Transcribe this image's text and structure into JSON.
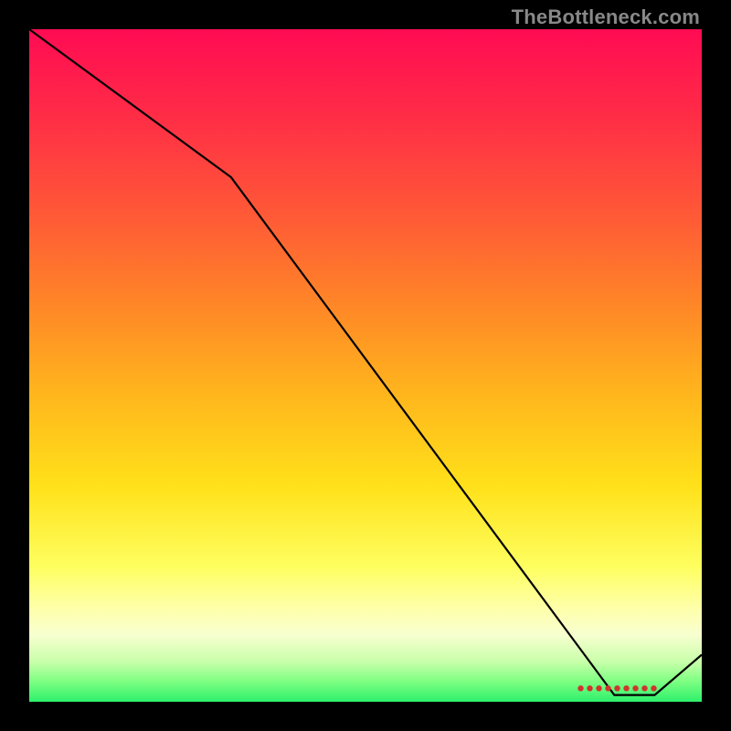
{
  "watermark": "TheBottleneck.com",
  "chart_data": {
    "type": "line",
    "title": "",
    "xlabel": "",
    "ylabel": "",
    "xlim": [
      0,
      100
    ],
    "ylim": [
      0,
      100
    ],
    "x": [
      0,
      30,
      87,
      93,
      100
    ],
    "values": [
      100,
      78,
      1,
      1,
      7
    ],
    "marker_band": {
      "x_start": 82,
      "x_end": 93,
      "y": 2
    },
    "gradient_stops": [
      {
        "pos": 0.0,
        "color": "#ff0b53"
      },
      {
        "pos": 0.12,
        "color": "#ff2a47"
      },
      {
        "pos": 0.28,
        "color": "#ff5a36"
      },
      {
        "pos": 0.42,
        "color": "#ff8a26"
      },
      {
        "pos": 0.55,
        "color": "#ffb81c"
      },
      {
        "pos": 0.68,
        "color": "#ffe11a"
      },
      {
        "pos": 0.8,
        "color": "#feff60"
      },
      {
        "pos": 0.86,
        "color": "#feffa8"
      },
      {
        "pos": 0.9,
        "color": "#f8ffd0"
      },
      {
        "pos": 0.94,
        "color": "#c9ffaa"
      },
      {
        "pos": 0.97,
        "color": "#7dff82"
      },
      {
        "pos": 1.0,
        "color": "#2df06c"
      }
    ]
  }
}
